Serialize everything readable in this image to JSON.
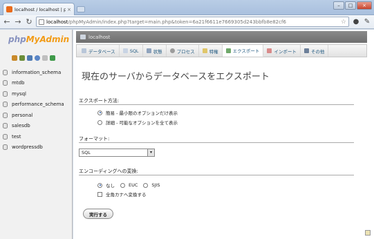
{
  "browser": {
    "tab_title": "localhost / localhost | phpMy",
    "tab_close": "×",
    "url_host": "localhost",
    "url_rest": "/phpMyAdmin/index.php?target=main.php&token=6a21f6611e7669305d243bbfb8e82cf6",
    "window_buttons": [
      "–",
      "□",
      "×"
    ],
    "icons": [
      "back-icon",
      "forward-icon",
      "reload-icon",
      "star-icon",
      "page-icon",
      "wrench-icon"
    ]
  },
  "navigation": {
    "logo_php": "php",
    "logo_myadmin": "MyAdmin",
    "quick_icons": [
      "home-icon",
      "sql-query-icon",
      "reload-icon",
      "help-icon",
      "docs-icon",
      "refresh-icon"
    ],
    "databases": [
      "information_schema",
      "mtdb",
      "mysql",
      "performance_schema",
      "personal",
      "salesdb",
      "test",
      "wordpressdb"
    ]
  },
  "main": {
    "server_label": "localhost",
    "tabs": [
      {
        "label": "データベース",
        "icon": "database-icon"
      },
      {
        "label": "SQL",
        "icon": "sql-icon"
      },
      {
        "label": "状態",
        "icon": "status-icon"
      },
      {
        "label": "プロセス",
        "icon": "process-icon"
      },
      {
        "label": "特権",
        "icon": "privileges-icon"
      },
      {
        "label": "エクスポート",
        "icon": "export-icon",
        "active": true
      },
      {
        "label": "インポート",
        "icon": "import-icon"
      },
      {
        "label": "その他",
        "icon": "more-icon"
      }
    ],
    "heading": "現在のサーバからデータベースをエクスポート",
    "export_method": {
      "label": "エクスポート方法:",
      "options": [
        "簡易 - 最小限のオプションだけ表示",
        "詳細 - 可能なオプションを全て表示"
      ],
      "selected": 0
    },
    "format": {
      "label": "フォーマット:",
      "value": "SQL",
      "arrow": "▾"
    },
    "encoding": {
      "label": "エンコーディングへの変換:",
      "options": [
        "なし",
        "EUC",
        "SJIS"
      ],
      "selected": 0,
      "checkbox_label": "全角カナへ変換する"
    },
    "go_button": "実行する"
  },
  "colors": {
    "logo_php": "#8892bf",
    "logo_myadmin": "#f29b16",
    "server_bar": "#7a7a7a",
    "tab_text": "#235a81"
  }
}
